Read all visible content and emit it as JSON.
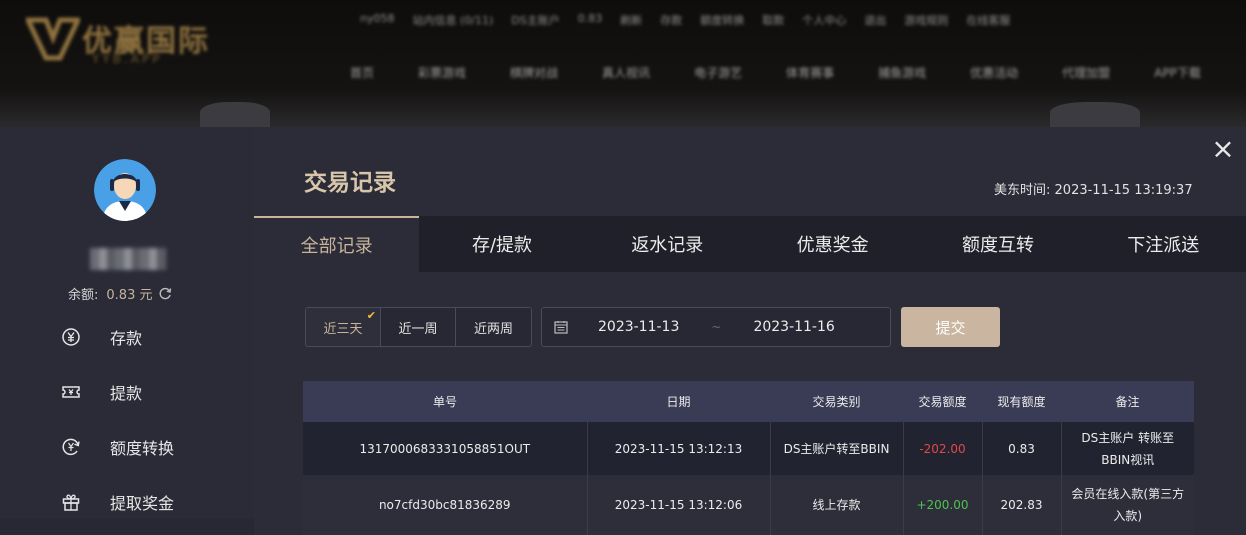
{
  "site": {
    "logo_text": "优赢国际",
    "logo_sub": "YYB.APP",
    "top_links": [
      "ny058",
      "站内信息 (0/11)",
      "DS主账户",
      "0.83",
      "刷新",
      "存款",
      "额度转换",
      "取款",
      "个人中心",
      "退出",
      "游戏规则",
      "在线客服"
    ],
    "nav_links": [
      "首页",
      "彩票游戏",
      "棋牌对战",
      "真人视讯",
      "电子游艺",
      "体育赛事",
      "捕鱼游戏",
      "优惠活动",
      "代理加盟",
      "APP下载"
    ]
  },
  "sidebar": {
    "balance_label": "余额:",
    "balance_value": "0.83 元",
    "menu": [
      {
        "label": "存款",
        "icon": "yuan-coin-icon"
      },
      {
        "label": "提款",
        "icon": "ticket-icon"
      },
      {
        "label": "额度转换",
        "icon": "transfer-coin-icon"
      },
      {
        "label": "提取奖金",
        "icon": "gift-icon"
      }
    ]
  },
  "header": {
    "title": "交易记录",
    "time_label": "美东时间:",
    "time_value": "2023-11-15 13:19:37",
    "close_label": "×"
  },
  "tabs": [
    {
      "label": "全部记录",
      "active": true
    },
    {
      "label": "存/提款",
      "active": false
    },
    {
      "label": "返水记录",
      "active": false
    },
    {
      "label": "优惠奖金",
      "active": false
    },
    {
      "label": "额度互转",
      "active": false
    },
    {
      "label": "下注派送",
      "active": false
    }
  ],
  "filters": {
    "ranges": [
      {
        "label": "近三天",
        "active": true
      },
      {
        "label": "近一周",
        "active": false
      },
      {
        "label": "近两周",
        "active": false
      }
    ],
    "start_date": "2023-11-13",
    "separator": "~",
    "end_date": "2023-11-16",
    "submit_label": "提交"
  },
  "table": {
    "columns": [
      "单号",
      "日期",
      "交易类别",
      "交易额度",
      "现有额度",
      "备注"
    ],
    "rows": [
      {
        "id": "1317000683331058851OUT",
        "date": "2023-11-15 13:12:13",
        "type": "DS主账户转至BBIN",
        "amount": "-202.00",
        "balance": "0.83",
        "note": "DS主账户 转账至 BBIN视讯"
      },
      {
        "id": "no7cfd30bc81836289",
        "date": "2023-11-15 13:12:06",
        "type": "线上存款",
        "amount": "+200.00",
        "balance": "202.83",
        "note": "会员在线入款(第三方入款)"
      }
    ]
  },
  "colors": {
    "accent": "#c8b49b",
    "negative": "#e04848",
    "positive": "#4fc24f",
    "header_row": "#3a3c55"
  }
}
